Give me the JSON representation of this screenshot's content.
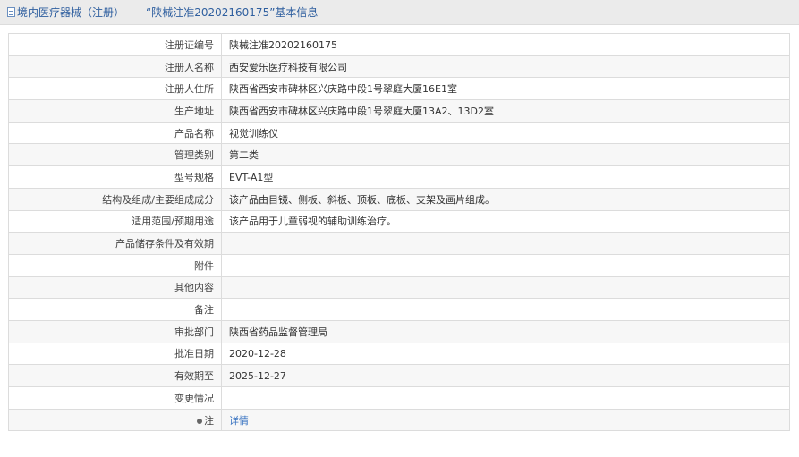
{
  "header": {
    "title": "境内医疗器械（注册）——“陕械注准20202160175”基本信息",
    "icon": "document-icon"
  },
  "rows": [
    {
      "label": "注册证编号",
      "value": "陕械注准20202160175"
    },
    {
      "label": "注册人名称",
      "value": "西安爱乐医疗科技有限公司"
    },
    {
      "label": "注册人住所",
      "value": "陕西省西安市碑林区兴庆路中段1号翠庭大厦16E1室"
    },
    {
      "label": "生产地址",
      "value": "陕西省西安市碑林区兴庆路中段1号翠庭大厦13A2、13D2室"
    },
    {
      "label": "产品名称",
      "value": "视觉训练仪"
    },
    {
      "label": "管理类别",
      "value": "第二类"
    },
    {
      "label": "型号规格",
      "value": "EVT-A1型"
    },
    {
      "label": "结构及组成/主要组成成分",
      "value": "该产品由目镜、侧板、斜板、顶板、底板、支架及画片组成。"
    },
    {
      "label": "适用范围/预期用途",
      "value": "该产品用于儿童弱视的辅助训练治疗。"
    },
    {
      "label": "产品储存条件及有效期",
      "value": ""
    },
    {
      "label": "附件",
      "value": ""
    },
    {
      "label": "其他内容",
      "value": ""
    },
    {
      "label": "备注",
      "value": ""
    },
    {
      "label": "审批部门",
      "value": "陕西省药品监督管理局"
    },
    {
      "label": "批准日期",
      "value": "2020-12-28"
    },
    {
      "label": "有效期至",
      "value": "2025-12-27"
    },
    {
      "label": "变更情况",
      "value": ""
    }
  ],
  "note_row": {
    "label": "注",
    "icon": "pin-icon",
    "link_text": "详情"
  },
  "colors": {
    "header_bg": "#ebebeb",
    "header_text": "#2f5f9f",
    "link": "#3a74c2",
    "border": "#dcdcdc"
  }
}
